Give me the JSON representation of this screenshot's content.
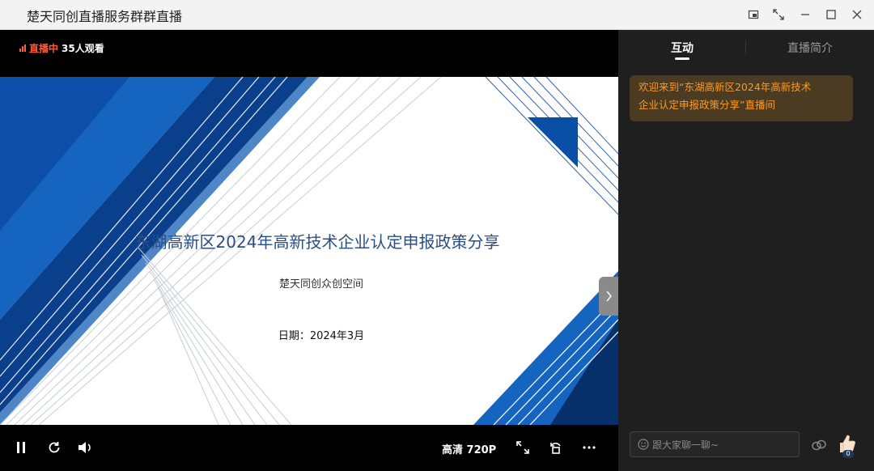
{
  "window": {
    "title": "楚天同创直播服务群群直播",
    "controls": [
      "pip-icon",
      "fullscreen-icon",
      "minimize-icon",
      "maximize-icon",
      "close-icon"
    ]
  },
  "player": {
    "live_label": "直播中",
    "viewers": "35人观看",
    "slide": {
      "title": "东湖高新区2024年高新技术企业认定申报政策分享",
      "subtitle": "楚天同创众创空间",
      "date": "日期：2024年3月"
    },
    "controls": {
      "quality": "高清 720P"
    },
    "colors": {
      "live": "#ff5a3c",
      "slide_blue": "#0a4fa6",
      "slide_dark": "#07306a"
    }
  },
  "sidebar": {
    "tabs": [
      {
        "label": "互动",
        "active": true
      },
      {
        "label": "直播简介",
        "active": false
      }
    ],
    "welcome": {
      "line1": "欢迎来到“东湖高新区2024年高新技术",
      "line2": "企业认定申报政策分享”直播间"
    },
    "chat": {
      "placeholder": "跟大家聊一聊~"
    },
    "like_count": "0"
  }
}
